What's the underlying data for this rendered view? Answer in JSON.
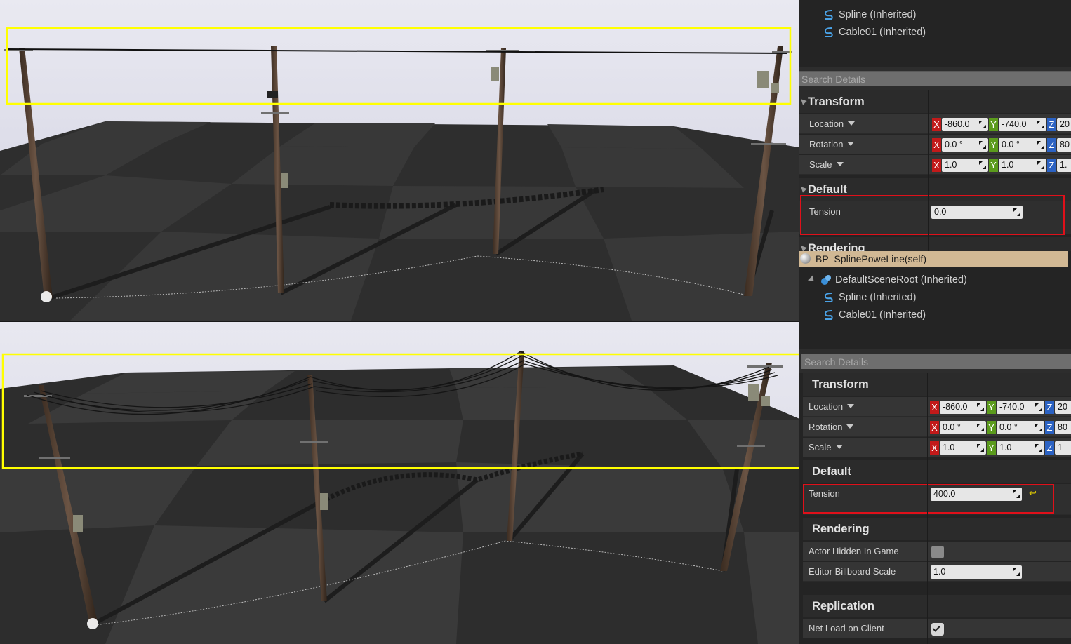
{
  "top_panel": {
    "tree": {
      "items": [
        {
          "label": "Spline (Inherited)",
          "icon": "spline-icon"
        },
        {
          "label": "Cable01 (Inherited)",
          "icon": "spline-icon"
        }
      ]
    },
    "search_placeholder": "Search Details",
    "transform": {
      "title": "Transform",
      "rows": [
        {
          "label": "Location",
          "x": "-860.0",
          "y": "-740.0",
          "z": "20"
        },
        {
          "label": "Rotation",
          "x": "0.0 °",
          "y": "0.0 °",
          "z": "80"
        },
        {
          "label": "Scale",
          "x": "1.0",
          "y": "1.0",
          "z": "1."
        }
      ]
    },
    "default": {
      "title": "Default",
      "tension_label": "Tension",
      "tension_value": "0.0"
    },
    "rendering_title": "Rendering"
  },
  "bottom_panel": {
    "self_label": "BP_SplinePoweLine(self)",
    "tree": {
      "root": {
        "label": "DefaultSceneRoot (Inherited)",
        "icon": "scene-root-icon"
      },
      "items": [
        {
          "label": "Spline (Inherited)",
          "icon": "spline-icon"
        },
        {
          "label": "Cable01 (Inherited)",
          "icon": "spline-icon"
        }
      ]
    },
    "search_placeholder": "Search Details",
    "transform": {
      "title": "Transform",
      "rows": [
        {
          "label": "Location",
          "x": "-860.0",
          "y": "-740.0",
          "z": "20"
        },
        {
          "label": "Rotation",
          "x": "0.0 °",
          "y": "0.0 °",
          "z": "80"
        },
        {
          "label": "Scale",
          "x": "1.0",
          "y": "1.0",
          "z": "1"
        }
      ]
    },
    "default": {
      "title": "Default",
      "tension_label": "Tension",
      "tension_value": "400.0"
    },
    "rendering": {
      "title": "Rendering",
      "actor_hidden_label": "Actor Hidden In Game",
      "actor_hidden_checked": false,
      "billboard_label": "Editor Billboard Scale",
      "billboard_value": "1.0"
    },
    "replication": {
      "title": "Replication",
      "net_load_label": "Net Load on Client",
      "net_load_checked": true
    }
  },
  "colors": {
    "highlight_yellow": "#ffff00",
    "highlight_red": "#e0101a",
    "axis_x": "#c21a1a",
    "axis_y": "#5b9b1c",
    "axis_z": "#2b62c3",
    "self_row": "#d1b894"
  }
}
